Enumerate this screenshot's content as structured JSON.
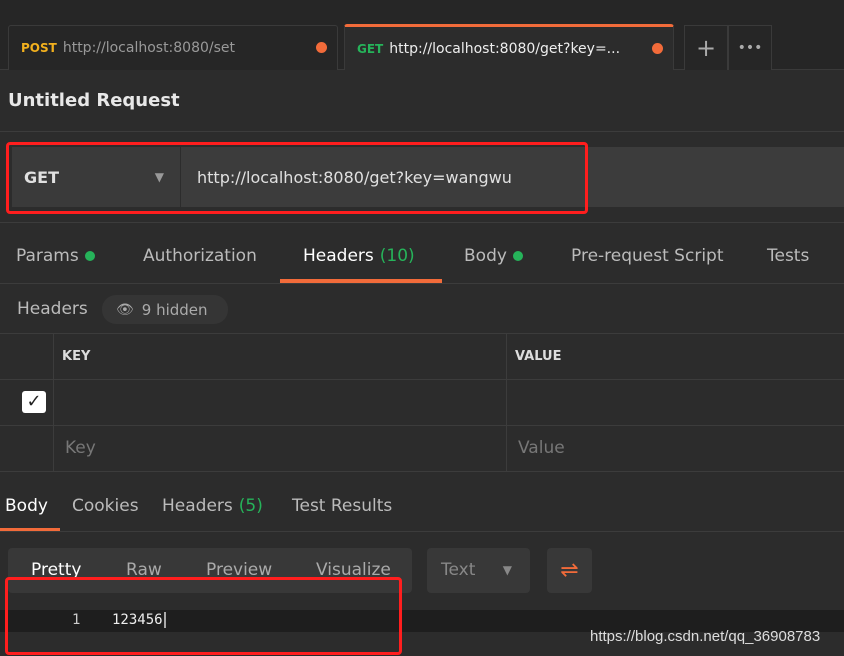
{
  "tabs": [
    {
      "method": "POST",
      "url": "http://localhost:8080/set",
      "unsaved": true
    },
    {
      "method": "GET",
      "url": "http://localhost:8080/get?key=...",
      "unsaved": true,
      "active": true
    }
  ],
  "tab_actions": {
    "new_tab": "+",
    "more": "•••"
  },
  "request": {
    "title": "Untitled Request",
    "method": "GET",
    "url": "http://localhost:8080/get?key=wangwu"
  },
  "request_tabs": [
    {
      "label": "Params",
      "dot": true
    },
    {
      "label": "Authorization"
    },
    {
      "label": "Headers",
      "count": "(10)",
      "active": true
    },
    {
      "label": "Body",
      "dot": true
    },
    {
      "label": "Pre-request Script"
    },
    {
      "label": "Tests"
    }
  ],
  "headers": {
    "label": "Headers",
    "hidden": "9 hidden",
    "columns": [
      "KEY",
      "VALUE"
    ],
    "key_placeholder": "Key",
    "value_placeholder": "Value"
  },
  "response_tabs": [
    {
      "label": "Body",
      "active": true
    },
    {
      "label": "Cookies"
    },
    {
      "label": "Headers",
      "count": "(5)"
    },
    {
      "label": "Test Results"
    }
  ],
  "body_view": {
    "modes": [
      "Pretty",
      "Raw",
      "Preview",
      "Visualize"
    ],
    "format": "Text",
    "selected_mode": "Pretty"
  },
  "response_body": {
    "line_number": "1",
    "content": "123456"
  },
  "watermark": "https://blog.csdn.net/qq_36908783",
  "colors": {
    "accent": "#f26b3a",
    "get": "#26b35a",
    "post": "#f2b01e",
    "highlight": "#ff1e1e"
  }
}
